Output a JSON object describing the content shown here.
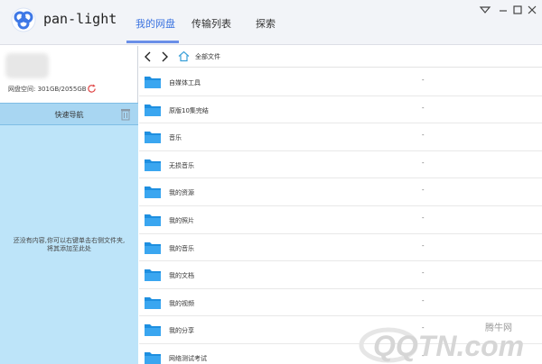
{
  "app": {
    "title": "pan-light"
  },
  "tabs": [
    {
      "label": "我的网盘",
      "active": true
    },
    {
      "label": "传输列表",
      "active": false
    },
    {
      "label": "探索",
      "active": false
    }
  ],
  "window_controls": [
    "minimize-to-tray",
    "minimize",
    "maximize",
    "close"
  ],
  "account": {
    "storage_text": "网盘空间: 301GB/2055GB"
  },
  "quick_nav": {
    "label": "快速导航",
    "empty_text_line1": "还没有内容,你可以右键单击右侧文件夹,",
    "empty_text_line2": "将其添加至此处"
  },
  "toolbar": {
    "breadcrumb": "全部文件"
  },
  "files": [
    {
      "name": "自媒体工具",
      "size": "-"
    },
    {
      "name": "原版10集完结",
      "size": "-"
    },
    {
      "name": "音乐",
      "size": "-"
    },
    {
      "name": "无损音乐",
      "size": "-"
    },
    {
      "name": "我的资源",
      "size": "-"
    },
    {
      "name": "我的照片",
      "size": "-"
    },
    {
      "name": "我的音乐",
      "size": "-"
    },
    {
      "name": "我的文档",
      "size": "-"
    },
    {
      "name": "我的视频",
      "size": "-"
    },
    {
      "name": "我的分享",
      "size": "-"
    },
    {
      "name": "网络测试考试",
      "size": "-"
    }
  ],
  "watermark": {
    "brand_cn": "腾牛网",
    "brand_en": "QQTN.com"
  },
  "colors": {
    "accent": "#3b73e0",
    "folder": "#1e8fe0",
    "quicknav_bg": "#a8d6f2",
    "nav_bg": "#bde4f9"
  }
}
